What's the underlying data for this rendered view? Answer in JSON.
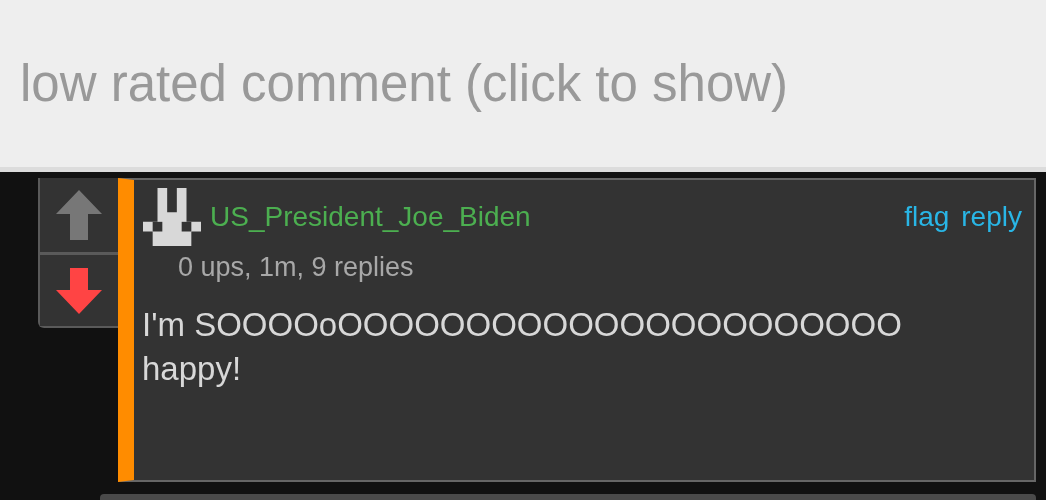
{
  "collapsed_bar": {
    "label": "low rated comment (click to show)"
  },
  "votes": [
    {
      "kind": "up",
      "selected": false
    },
    {
      "kind": "down",
      "selected": true
    }
  ],
  "comment": {
    "username": "US_President_Joe_Biden",
    "meta": "0 ups, 1m, 9 replies",
    "actions": [
      "flag",
      "reply"
    ],
    "text": "I'm SOOOOoOOOOOOOOOOOOOOOOOOOOOO happy!"
  }
}
